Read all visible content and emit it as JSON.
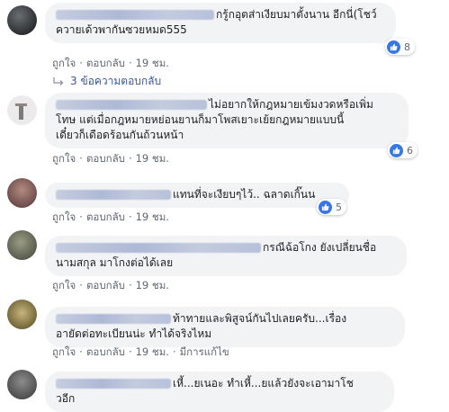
{
  "actions": {
    "like": "ถูกใจ",
    "reply": "ตอบกลับ",
    "sep": "·"
  },
  "comments": [
    {
      "text_l1": "กรู้กอุตส่าเงียบมาตั้งนาน อีกนี่(โชว์",
      "text_l2": "ควายเด้วพากันซวยหมด555",
      "time": "19 ชม.",
      "reactions": "8",
      "replies": "3 ข้อความตอบกลับ"
    },
    {
      "text_l1": "ไม่อยากให้กฎหมายเข้มงวดหรือเพิ่ม",
      "text_l2": "โทษ แต่เมื่อกฎหมายหย่อนยานก็มาโพสเยาะเย้ยกฎหมายแบบนี้",
      "text_l3": "เดี๋ยวก็เดือดร้อนกันถ้วนหน้า",
      "time": "19 ชม.",
      "reactions": "6"
    },
    {
      "text_l1": "แทนที่จะเงียบๆไว้.. ฉลาดเกิ๊นน",
      "time": "19 ชม.",
      "reactions": "5"
    },
    {
      "text_l1": "กรณีฉ้อโกง ยังเปลี่ยนชื่อ",
      "text_l2": "นามสกุล มาโกงต่อได้เลย",
      "time": "19 ชม."
    },
    {
      "text_l1": "ท้าทายและพิสูจน์กันไปเลยครับ...เรื่อง",
      "text_l2": "อายัดต่อทะเบียนน่ะ ทำได้จริงไหม",
      "time": "19 ชม.",
      "edited": "มีการแก้ไข"
    },
    {
      "text_l1": "เหี้...ยเนอะ ทำเหี้...ยแล้วยังจะเอามาโช",
      "text_l2": "วอีก"
    }
  ],
  "colors": {
    "link": "#385898",
    "like_blue": "#3578e5",
    "bubble": "#f2f3f5",
    "meta": "#606770"
  },
  "icons": [
    "like-icon",
    "reply-arrow-icon"
  ]
}
